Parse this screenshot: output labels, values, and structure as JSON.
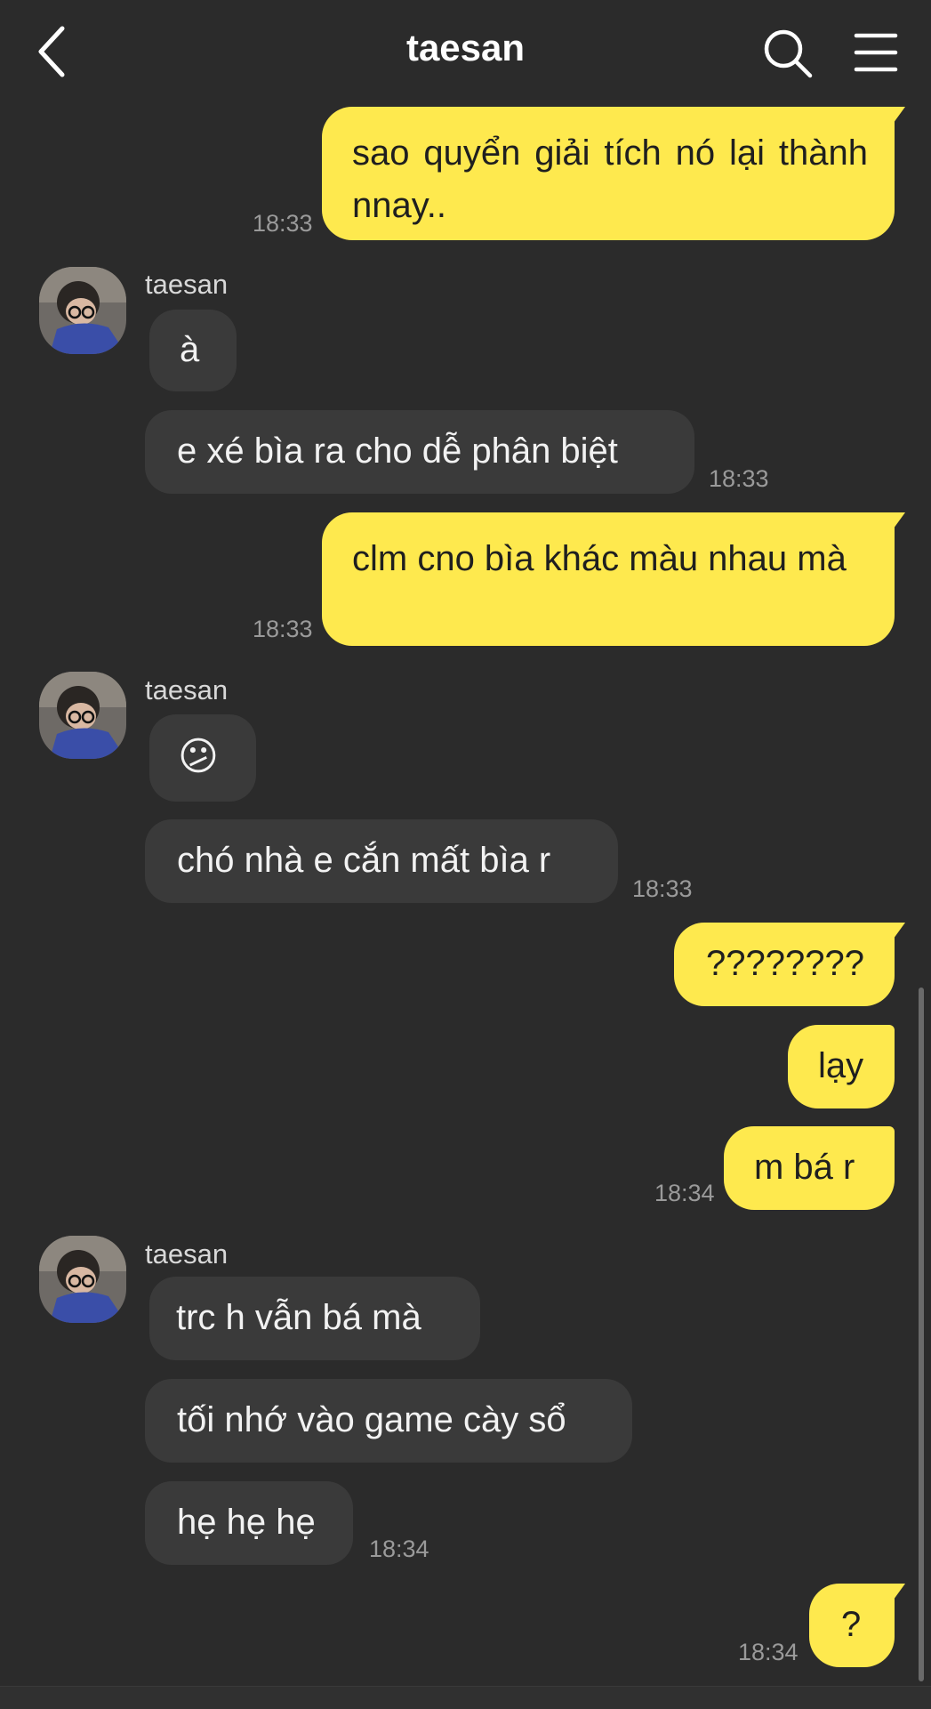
{
  "header": {
    "title": "taesan",
    "back_icon": "chevron-left-icon",
    "search_icon": "search-icon",
    "menu_icon": "hamburger-menu-icon"
  },
  "colors": {
    "background": "#2b2b2b",
    "outgoing_bubble": "#fee94e",
    "incoming_bubble": "#3a3a3a"
  },
  "messages": {
    "m1": {
      "text": "sao quyển giải tích nó lại thành nnay..",
      "time": "18:33"
    },
    "m2": {
      "sender": "taesan",
      "text": "à"
    },
    "m3": {
      "text": "e xé bìa ra cho dễ phân biệt",
      "time": "18:33"
    },
    "m4": {
      "text": "clm cno bìa khác màu nhau mà",
      "time": "18:33"
    },
    "m5": {
      "sender": "taesan",
      "text": "😕"
    },
    "m6": {
      "text": "chó nhà e cắn mất bìa r",
      "time": "18:33"
    },
    "m7": {
      "text": "????????"
    },
    "m8": {
      "text": "lạy"
    },
    "m9": {
      "text": "m bá r",
      "time": "18:34"
    },
    "m10": {
      "sender": "taesan",
      "text": "trc h vẫn bá mà"
    },
    "m11": {
      "text": "tối nhớ vào game cày sổ"
    },
    "m12": {
      "text": "hẹ hẹ hẹ",
      "time": "18:34"
    },
    "m13": {
      "text": "?",
      "time": "18:34"
    }
  }
}
